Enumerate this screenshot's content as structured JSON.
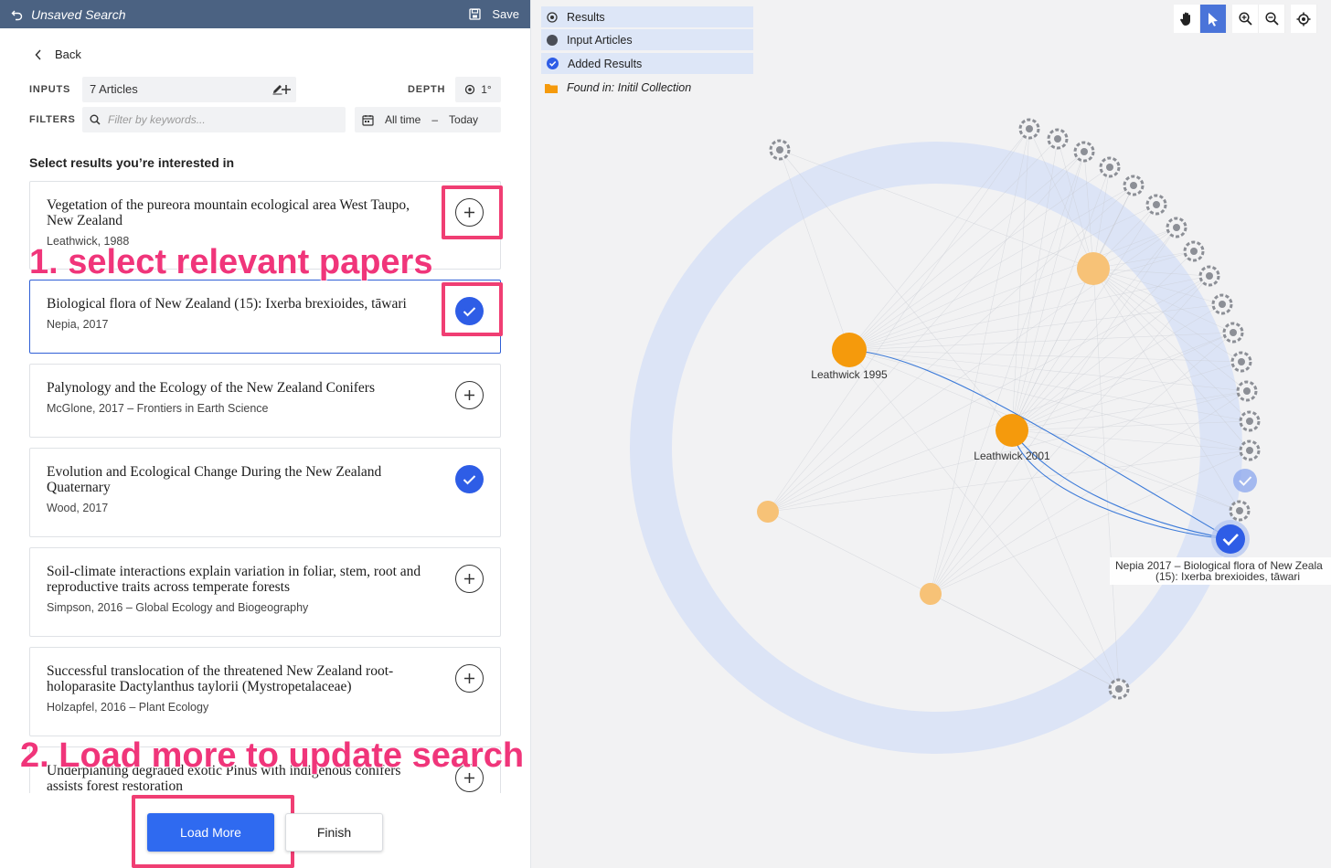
{
  "topbar": {
    "title": "Unsaved Search",
    "save_label": "Save"
  },
  "back_label": "Back",
  "inputs": {
    "label": "INPUTS",
    "value": "7 Articles",
    "depth_label": "DEPTH",
    "depth_value": "1°"
  },
  "filters": {
    "label": "FILTERS",
    "placeholder": "Filter by keywords...",
    "date_from": "All time",
    "date_sep": "–",
    "date_to": "Today"
  },
  "section_title": "Select results you’re interested in",
  "results": [
    {
      "title": "Vegetation of the pureora mountain ecological area West Taupo, New Zealand",
      "meta": "Leathwick, 1988",
      "selected": false
    },
    {
      "title": "Biological flora of New Zealand (15): Ixerba brexioides, tāwari",
      "meta": "Nepia, 2017",
      "selected": true
    },
    {
      "title": "Palynology and the Ecology of the New Zealand Conifers",
      "meta": "McGlone, 2017 – Frontiers in Earth Science",
      "selected": false
    },
    {
      "title": "Evolution and Ecological Change During the New Zealand Quaternary",
      "meta": "Wood, 2017",
      "selected": true
    },
    {
      "title": "Soil-climate interactions explain variation in foliar, stem, root and reproductive traits across temperate forests",
      "meta": "Simpson, 2016 – Global Ecology and Biogeography",
      "selected": false
    },
    {
      "title": "Successful translocation of the threatened New Zealand root-holoparasite Dactylanthus taylorii (Mystropetalaceae)",
      "meta": "Holzapfel, 2016 – Plant Ecology",
      "selected": false
    },
    {
      "title": "Underplanting degraded exotic Pinus with indigenous conifers assists forest restoration",
      "meta": "",
      "selected": false
    }
  ],
  "annotations": {
    "step1": "1. select relevant papers",
    "step2": "2. Load more to update search"
  },
  "buttons": {
    "load_more": "Load More",
    "finish": "Finish"
  },
  "legend": {
    "results": "Results",
    "input_articles": "Input Articles",
    "added_results": "Added Results",
    "found_in": "Found in: Initil Collection"
  },
  "graph": {
    "labels": {
      "leathwick1995": "Leathwick 1995",
      "leathwick2001": "Leathwick 2001",
      "nepia_line1": "Nepia 2017 – Biological flora of New Zeala",
      "nepia_line2": "(15): Ixerba brexioides, tāwari"
    }
  },
  "colors": {
    "accent": "#2f6af0",
    "topbar": "#4b6282",
    "highlight": "#f03e73",
    "annotation": "#f0357a",
    "input_node": "#f59a0c",
    "ring": "#dce4f6"
  },
  "toolbar_icons": [
    "hand-icon",
    "pointer-icon",
    "zoom-in-icon",
    "zoom-out-icon",
    "locate-icon"
  ]
}
